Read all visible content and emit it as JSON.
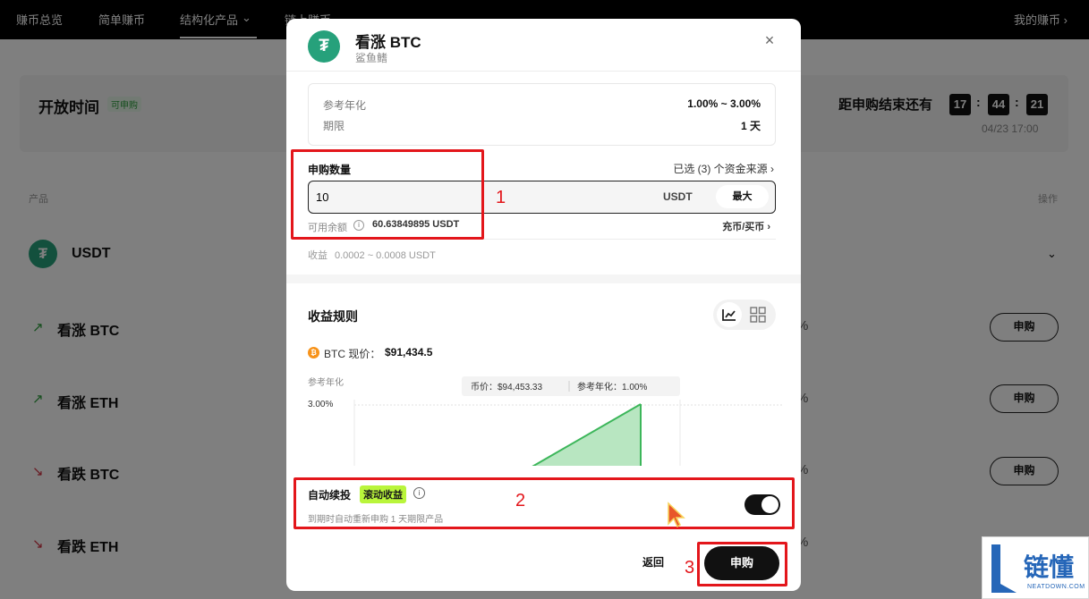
{
  "top_nav": {
    "items": [
      "赚币总览",
      "简单赚币",
      "结构化产品",
      "链上赚币"
    ],
    "active_caret": "⌄",
    "right_link": "我的赚币 ›"
  },
  "banner": {
    "open_time_label": "开放时间",
    "open_badge": "可申购",
    "countdown_label": "距申购结束还有",
    "hh": "17",
    "mm": "44",
    "ss": "21",
    "end_date": "04/23 17:00"
  },
  "table": {
    "col_product": "产品",
    "col_action": "操作",
    "rows": [
      {
        "name": "USDT",
        "logo": "₮"
      },
      {
        "name": "看涨 BTC",
        "arrow": "↗",
        "pct": "%",
        "btn": "申购"
      },
      {
        "name": "看涨 ETH",
        "arrow": "↗",
        "pct": "%",
        "btn": "申购"
      },
      {
        "name": "看跌 BTC",
        "arrow": "↘",
        "pct": "%",
        "btn": "申购"
      },
      {
        "name": "看跌 ETH",
        "arrow": "↘",
        "pct": "%",
        "btn": "申购"
      }
    ]
  },
  "modal": {
    "logo": "₮",
    "title": "看涨 BTC",
    "subtitle": "鲨鱼鳍",
    "close": "×",
    "ref_apr_label": "参考年化",
    "ref_apr_value": "1.00% ~ 3.00%",
    "term_label": "期限",
    "term_value": "1 天",
    "amount_label": "申购数量",
    "sources_link": "已选 (3) 个资金来源 ›",
    "amount_value": "10",
    "amount_unit": "USDT",
    "max_label": "最大",
    "balance_label": "可用余额",
    "balance_value": "60.63849895 USDT",
    "deposit_link": "充币/买币 ›",
    "earnings_label": "收益",
    "earnings_value": "0.0002 ~ 0.0008 USDT",
    "rules_title": "收益规则",
    "btc_price_label": "BTC 现价：",
    "btc_price": "$91,434.5",
    "auto_title": "自动续投",
    "roll_badge": "滚动收益",
    "auto_desc": "到期时自动重新申购 1 天期限产品",
    "back_label": "返回",
    "submit_label": "申购"
  },
  "chart_data": {
    "type": "area",
    "ylabel": "参考年化",
    "y_tick": "3.00%",
    "tooltip_price": "币价：$94,453.33",
    "tooltip_apr": "参考年化：1.00%",
    "colors": {
      "fill": "#b8e6c1",
      "stroke": "#3cb65a"
    }
  },
  "annotations": {
    "n1": "1",
    "n2": "2",
    "n3": "3"
  },
  "watermark": {
    "text": "链懂",
    "sub": "NEATDOWN.COM"
  }
}
